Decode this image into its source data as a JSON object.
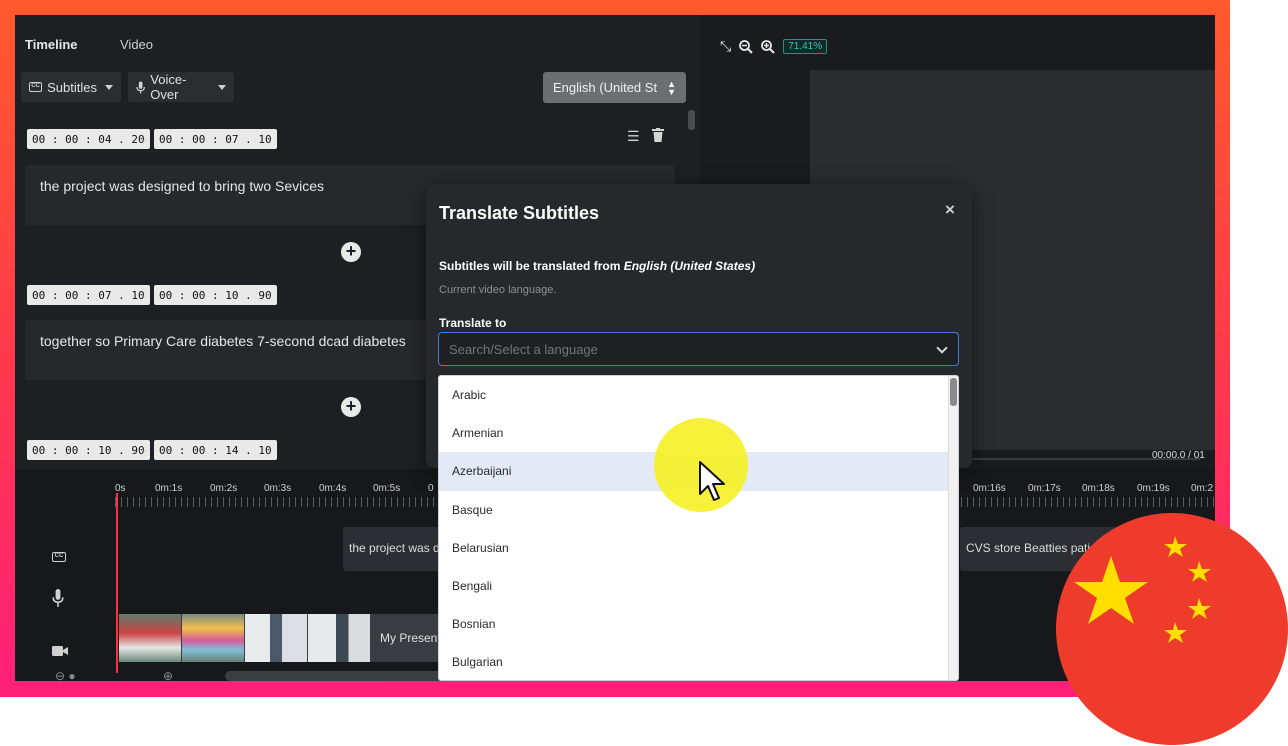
{
  "colors": {
    "frame_top": "#ff5a2d",
    "frame_bottom": "#ff1f7a",
    "app_bg": "#1b1c1f",
    "accent_blue": "#3b7ee0",
    "playhead": "#ff2f3e",
    "zoom_teal": "#2fc8b8",
    "flag_red": "#ee3b2b",
    "flag_star": "#ffde00"
  },
  "tabs": {
    "timeline": "Timeline",
    "video": "Video"
  },
  "toolbar": {
    "subtitles_label": "Subtitles",
    "voiceover_label": "Voice-Over",
    "language_value": "English (United St"
  },
  "subtitles": [
    {
      "start": "00 : 00 : 04 . 20",
      "end": "00 : 00 : 07 . 10",
      "text": "the project was designed to bring two Sevices"
    },
    {
      "start": "00 : 00 : 07 . 10",
      "end": "00 : 00 : 10 . 90",
      "text": "together so Primary Care diabetes 7-second dcad diabetes"
    },
    {
      "start": "00 : 00 : 10 . 90",
      "end": "00 : 00 : 14 . 10"
    }
  ],
  "time_separator": "-",
  "preview": {
    "zoom_level": "71.41%",
    "time": "00:00.0 / 01"
  },
  "timeline": {
    "ruler_left": [
      "0s",
      "0m:1s",
      "0m:2s",
      "0m:3s",
      "0m:4s",
      "0m:5s",
      "0"
    ],
    "ruler_right": [
      "0m:16s",
      "0m:17s",
      "0m:18s",
      "0m:19s",
      "0m:2"
    ],
    "subtitle_clip_left": "the project was d",
    "subtitle_clip_right": "CVS store Beatties patient n",
    "video_clip_label": "My Present"
  },
  "modal": {
    "title": "Translate Subtitles",
    "from_prefix": "Subtitles will be translated from",
    "from_language": "English (United States)",
    "hint": "Current video language.",
    "translate_to_label": "Translate to",
    "placeholder": "Search/Select a language",
    "close_glyph": "×"
  },
  "languages": [
    "Arabic",
    "Armenian",
    "Azerbaijani",
    "Basque",
    "Belarusian",
    "Bengali",
    "Bosnian",
    "Bulgarian"
  ],
  "highlighted_language": "Azerbaijani"
}
